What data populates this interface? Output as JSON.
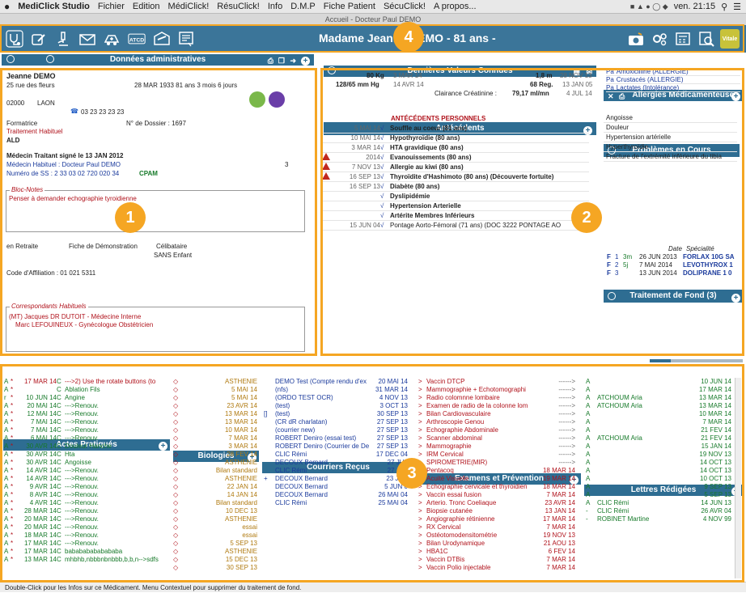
{
  "menubar": {
    "app": "MediClick Studio",
    "items": [
      "Fichier",
      "Edition",
      "MédiClick!",
      "RésuClick!",
      "Info",
      "D.M.P",
      "Fiche Patient",
      "SécuClick!",
      "A propos..."
    ],
    "clock": "ven. 21:15"
  },
  "window_title": "Accueil - Docteur Paul DEMO",
  "toolbar": {
    "patient": "Madame Jeanne DEMO - 81 ans  -",
    "left_icons": [
      "stethoscope-icon",
      "prescription-icon",
      "microscope-icon",
      "mail-icon",
      "ambulance-icon",
      "atcd-icon",
      "letter-icon",
      "form-icon"
    ],
    "atcd_label": "ATCD",
    "vitale_label": "Vitale"
  },
  "admin": {
    "header": "Données administratives",
    "name": "Jeanne DEMO",
    "address": "25 rue des fleurs",
    "birth": "28 MAR 1933  81 ans 3 mois 6 jours",
    "zip": "02000",
    "city": "LAON",
    "phone": "03 23 23 23 23",
    "job": "Formatrice",
    "dossier": "N° de Dossier : 1697",
    "treatment": "Traitement Habituel",
    "ald": "ALD",
    "doctor_sign": "Médecin Traitant signé le 13 JAN 2012",
    "doctor_habit": "Médecin Habituel : Docteur Paul DEMO",
    "doctor_num": "3",
    "ss": "Numéro de SS :  2 33 03 02 720 020 34",
    "cpam": "CPAM",
    "bloc_title": "Bloc-Notes",
    "bloc_text": "Penser à demander echographie tyroidienne",
    "retraite": "en Retraite",
    "fiche": "Fiche de Démonstration",
    "celib": "Célibataire",
    "enfant": "SANS Enfant",
    "affiliation": "Code d'Affiliation : 01  021  5311",
    "corr_title": "Correspondants Habituels",
    "corr": [
      "(MT) Jacques DR DUTOIT - Médecine Interne",
      "Marc LEFOUINEUX - Gynécologue Obstétricien"
    ]
  },
  "vals": {
    "header": "Dernières Valeurs Connues",
    "rows": [
      {
        "a": "80 Kg",
        "b": "3 MAR 14",
        "c": "1,8 m",
        "d": "28 NOV 13"
      },
      {
        "a": "128/65 mm Hg",
        "b": "14 AVR 14",
        "c": "68 Reg.",
        "d": "13 JAN 05"
      }
    ],
    "clairance": "Clairance Créatinine :",
    "clairance_val": "79,17 ml/mn",
    "clairance_date": "4 JUL 14"
  },
  "antecedents": {
    "header": "Antécédents",
    "section": "ANTÉCÉDENTS PERSONNELS",
    "rows": [
      {
        "date": "5 MAI 14",
        "text": "Souffle au coeur (81 ans)",
        "warn": false
      },
      {
        "date": "10 MAI 14",
        "text": "Hypothyroïdie (80 ans)",
        "warn": false
      },
      {
        "date": "3 MAR 14",
        "text": "HTA gravidique (80 ans)",
        "warn": false
      },
      {
        "date": "2014",
        "text": "Evanouissements (80 ans)",
        "warn": true
      },
      {
        "date": "7 NOV 13",
        "text": "Allergie au kiwi (80 ans)",
        "warn": true
      },
      {
        "date": "16 SEP 13",
        "text": "Thyroïdite d'Hashimoto (80 ans)  (Découverte fortuite)",
        "warn": true
      },
      {
        "date": "16 SEP 13",
        "text": "Diabète (80 ans)",
        "warn": false
      },
      {
        "date": "",
        "text": "Dyslipidémie",
        "warn": false
      },
      {
        "date": "",
        "text": "Hypertension Arterielle",
        "warn": false
      },
      {
        "date": "",
        "text": "Artérite Membres Inférieurs",
        "warn": false
      },
      {
        "date": "15 JUN 04",
        "text": "Pontage Aorto-Fémoral (71 ans)  (DOC 3222 PONTAGE AO",
        "warn": false
      }
    ]
  },
  "allergies": {
    "header": "Allergies Médicamenteuses",
    "rows": [
      "Amoxicilline (ALLERGIE)",
      "Crustacés (ALLERGIE)",
      "Lactates (Intolérance)"
    ]
  },
  "problemes": {
    "header": "Problèmes en Cours",
    "rows": [
      "Angoisse",
      "Douleur",
      "Hypertension artérielle",
      "Hyperthyroïdie",
      "Fracture de l'extrémité inférieure du tibia"
    ]
  },
  "traitement": {
    "header": "Traitement de Fond (3)",
    "col_date": "Date",
    "col_spec": "Spécialité",
    "rows": [
      {
        "f": "F",
        "n": "1",
        "d": "3m",
        "date": "26 JUN 2013",
        "drug": "FORLAX 10G SA"
      },
      {
        "f": "F",
        "n": "2",
        "d": "5j",
        "date": "7 MAI 2014",
        "drug": "LEVOTHYROX 1"
      },
      {
        "f": "F",
        "n": "3",
        "d": "",
        "date": "13 JUN 2014",
        "drug": "DOLIPRANE 1 0"
      }
    ]
  },
  "actes": {
    "header": "Actes Pratiqués",
    "rows": [
      {
        "m": "A",
        "date": "17 MAR 14",
        "c": "C",
        "t": "--->2) Use the rotate buttons (to",
        "red": true
      },
      {
        "m": "A",
        "date": "",
        "c": "C",
        "t": "Ablation Fils",
        "red": false
      },
      {
        "m": "r",
        "date": "10 JUN 14",
        "c": "C",
        "t": "Angine",
        "red": false
      },
      {
        "m": "A",
        "date": "20 MAI 14",
        "c": "C",
        "t": "--->Renouv.",
        "red": false
      },
      {
        "m": "A",
        "date": "12 MAI 14",
        "c": "C",
        "t": "--->Renouv.",
        "red": false
      },
      {
        "m": "A",
        "date": "7 MAI 14",
        "c": "C",
        "t": "--->Renouv.",
        "red": false
      },
      {
        "m": "A",
        "date": "7 MAI 14",
        "c": "C",
        "t": "--->Renouv.",
        "red": false
      },
      {
        "m": "A",
        "date": "6 MAI 14",
        "c": "C",
        "t": "--->Renouv.",
        "red": false
      },
      {
        "m": "A",
        "date": "30 AVR 14",
        "c": "C",
        "t": "Douleur Hanche",
        "red": false
      },
      {
        "m": "A",
        "date": "30 AVR 14",
        "c": "C",
        "t": "Hta",
        "red": false
      },
      {
        "m": "A",
        "date": "30 AVR 14",
        "c": "C",
        "t": "Angoisse",
        "red": false
      },
      {
        "m": "A",
        "date": "14 AVR 14",
        "c": "C",
        "t": "--->Renouv.",
        "red": false
      },
      {
        "m": "A",
        "date": "14 AVR 14",
        "c": "C",
        "t": "--->Renouv.",
        "red": false
      },
      {
        "m": "A",
        "date": "9 AVR 14",
        "c": "C",
        "t": "--->Renouv.",
        "red": false
      },
      {
        "m": "A",
        "date": "8 AVR 14",
        "c": "C",
        "t": "--->Renouv.",
        "red": false
      },
      {
        "m": "A",
        "date": "4 AVR 14",
        "c": "C",
        "t": "--->Renouv.",
        "red": false
      },
      {
        "m": "A",
        "date": "28 MAR 14",
        "c": "C",
        "t": "--->Renouv.",
        "red": false
      },
      {
        "m": "A",
        "date": "20 MAR 14",
        "c": "C",
        "t": "--->Renouv.",
        "red": false
      },
      {
        "m": "A",
        "date": "20 MAR 14",
        "c": "C",
        "t": "--->Renouv.",
        "red": false
      },
      {
        "m": "A",
        "date": "18 MAR 14",
        "c": "C",
        "t": "--->Renouv.",
        "red": false
      },
      {
        "m": "A",
        "date": "17 MAR 14",
        "c": "C",
        "t": "--->Renouv.",
        "red": false
      },
      {
        "m": "A",
        "date": "17 MAR 14",
        "c": "C",
        "t": "babababababababa",
        "red": false
      },
      {
        "m": "A",
        "date": "13 MAR 14",
        "c": "C",
        "t": "mhbhb,nbbbnbnbbb,b,b,n-->sdfs",
        "red": false
      }
    ]
  },
  "biologies": {
    "header": "Biologies",
    "rows": [
      {
        "l": "ASTHENIE",
        "d": ""
      },
      {
        "l": "",
        "d": "5 MAI 14"
      },
      {
        "l": "",
        "d": "5 MAI 14"
      },
      {
        "l": "",
        "d": "23 AVR 14"
      },
      {
        "l": "",
        "d": "13 MAR 14"
      },
      {
        "l": "",
        "d": "13 MAR 14"
      },
      {
        "l": "",
        "d": "10 MAR 14"
      },
      {
        "l": "",
        "d": "7 MAR 14"
      },
      {
        "l": "",
        "d": "3 MAR 14"
      },
      {
        "l": "",
        "d": "28 FEV 14"
      },
      {
        "l": "ASTHENIE",
        "d": ""
      },
      {
        "l": "Bilan standard",
        "d": ""
      },
      {
        "l": "ASTHENIE",
        "d": ""
      },
      {
        "l": "",
        "d": "22 JAN 14"
      },
      {
        "l": "",
        "d": "14 JAN 14"
      },
      {
        "l": "Bilan standard",
        "d": ""
      },
      {
        "l": "",
        "d": "10 DEC 13"
      },
      {
        "l": "ASTHENIE",
        "d": ""
      },
      {
        "l": "essai",
        "d": ""
      },
      {
        "l": "essai",
        "d": ""
      },
      {
        "l": "",
        "d": "5 SEP 13"
      },
      {
        "l": "ASTHENIE",
        "d": ""
      },
      {
        "l": "",
        "d": "15 DEC 13"
      },
      {
        "l": "",
        "d": "30 SEP 13"
      }
    ]
  },
  "courriers": {
    "header": "Courriers Reçus",
    "rows": [
      {
        "p": "",
        "t": "DEMO Test (Compte rendu d'ex",
        "d": "20 MAI 14"
      },
      {
        "p": "",
        "t": "(nfs)",
        "d": "31 MAR 14"
      },
      {
        "p": "",
        "t": "(ORDO TEST OCR)",
        "d": "4 NOV 13"
      },
      {
        "p": "",
        "t": "(test)",
        "d": "3 OCT 13"
      },
      {
        "p": "[]",
        "t": "(test)",
        "d": "30 SEP 13"
      },
      {
        "p": "",
        "t": "(CR dR charlatan)",
        "d": "27 SEP 13"
      },
      {
        "p": "",
        "t": "(courrier new)",
        "d": "27 SEP 13"
      },
      {
        "p": "",
        "t": "ROBERT Deniro (essai test)",
        "d": "27 SEP 13"
      },
      {
        "p": "",
        "t": "ROBERT Deniro (Courrier de De",
        "d": "27 SEP 13"
      },
      {
        "p": "",
        "t": "CLIC Rémi",
        "d": "17 DEC 04"
      },
      {
        "p": "",
        "t": "DECOUX Bernard",
        "d": "27 JUL"
      },
      {
        "p": "",
        "t": "CLIC Rémi",
        "d": "27 JUL"
      },
      {
        "p": "+",
        "t": "DECOUX Bernard",
        "d": "23 JUN"
      },
      {
        "p": "",
        "t": "DECOUX Bernard",
        "d": "5 JUN 0"
      },
      {
        "p": "",
        "t": "DECOUX Bernard",
        "d": "26 MAI 04"
      },
      {
        "p": "",
        "t": "CLIC Rémi",
        "d": "25 MAI 04"
      }
    ]
  },
  "examens": {
    "header": "Examens et Prévention",
    "rows": [
      {
        "t": "Vaccin DTCP",
        "a": "------>",
        "d": ""
      },
      {
        "t": "Mammographie + Echotomographi",
        "a": "------>",
        "d": ""
      },
      {
        "t": "Radio colomnne lombaire",
        "a": "------>",
        "d": ""
      },
      {
        "t": "Examen de radio de la colonne lom",
        "a": "------>",
        "d": ""
      },
      {
        "t": "Bilan Cardiovasculaire",
        "a": "------>",
        "d": ""
      },
      {
        "t": "Arthroscopie Genou",
        "a": "------>",
        "d": ""
      },
      {
        "t": "Echographie Abdominale",
        "a": "------>",
        "d": ""
      },
      {
        "t": "Scanner abdominal",
        "a": "------>",
        "d": ""
      },
      {
        "t": "Mammographie",
        "a": "------>",
        "d": ""
      },
      {
        "t": "IRM Cervical",
        "a": "------>",
        "d": ""
      },
      {
        "t": "SPIROMETRIE(MIR)",
        "a": "------>",
        "d": ""
      },
      {
        "t": "Pentacoq",
        "a": "",
        "d": "18 MAR 14"
      },
      {
        "t": "Acuité Visuelle",
        "a": "",
        "d": "19 MAR 14"
      },
      {
        "t": "Echographie cervicale et thyroidien",
        "a": "",
        "d": "18 MAR 14"
      },
      {
        "t": "Vaccin essai fusion",
        "a": "",
        "d": "7 MAR 14"
      },
      {
        "t": "Arterio. Tronc Coeliaque",
        "a": "",
        "d": "23 AVR 14"
      },
      {
        "t": "Biopsie cutanée",
        "a": "",
        "d": "13 JAN 14"
      },
      {
        "t": "Angiographie rétinienne",
        "a": "",
        "d": "17 MAR 14"
      },
      {
        "t": "RX Cervical",
        "a": "",
        "d": "7 MAR 14"
      },
      {
        "t": "Ostéotomodensitométrie",
        "a": "",
        "d": "19 NOV 13"
      },
      {
        "t": "Bilan Urodynamique",
        "a": "",
        "d": "21 AOU 13"
      },
      {
        "t": "HBA1C",
        "a": "",
        "d": "6 FEV 14"
      },
      {
        "t": "Vaccin DTBis",
        "a": "",
        "d": "7 MAR 14"
      },
      {
        "t": "Vaccin Polio injectable",
        "a": "",
        "d": "7 MAR 14"
      }
    ]
  },
  "lettres": {
    "header": "Lettres Rédigées",
    "rows": [
      {
        "m": "A",
        "t": "",
        "d": "10 JUN 14"
      },
      {
        "m": "A",
        "t": "",
        "d": "17 MAR 14"
      },
      {
        "m": "A",
        "t": "ATCHOUM Aria",
        "d": "13 MAR 14"
      },
      {
        "m": "A",
        "t": "ATCHOUM Aria",
        "d": "13 MAR 14"
      },
      {
        "m": "A",
        "t": "",
        "d": "10 MAR 14"
      },
      {
        "m": "A",
        "t": "",
        "d": "7 MAR 14"
      },
      {
        "m": "A",
        "t": "",
        "d": "21 FEV 14"
      },
      {
        "m": "A",
        "t": "ATCHOUM Aria",
        "d": "21 FEV 14"
      },
      {
        "m": "A",
        "t": "",
        "d": "15 JAN 14"
      },
      {
        "m": "A",
        "t": "",
        "d": "19 NOV 13"
      },
      {
        "m": "A",
        "t": "",
        "d": "14 OCT 13"
      },
      {
        "m": "A",
        "t": "",
        "d": "14 OCT 13"
      },
      {
        "m": "A",
        "t": "",
        "d": "10 OCT 13"
      },
      {
        "m": "A",
        "t": "",
        "d": "9 SEP 13"
      },
      {
        "m": "A",
        "t": "",
        "d": "5 SEP 13"
      },
      {
        "m": "A",
        "t": "CLIC Rémi",
        "d": "14 JUN 13"
      },
      {
        "m": "-",
        "t": "CLIC Rémi",
        "d": "26 AVR 04"
      },
      {
        "m": "-",
        "t": "ROBINET Martine",
        "d": "4 NOV 99"
      }
    ]
  },
  "status": "Double-Click pour les Infos sur ce Médicament. Menu Contextuel pour supprimer du traitement de fond.",
  "badges": [
    "1",
    "2",
    "3",
    "4"
  ]
}
